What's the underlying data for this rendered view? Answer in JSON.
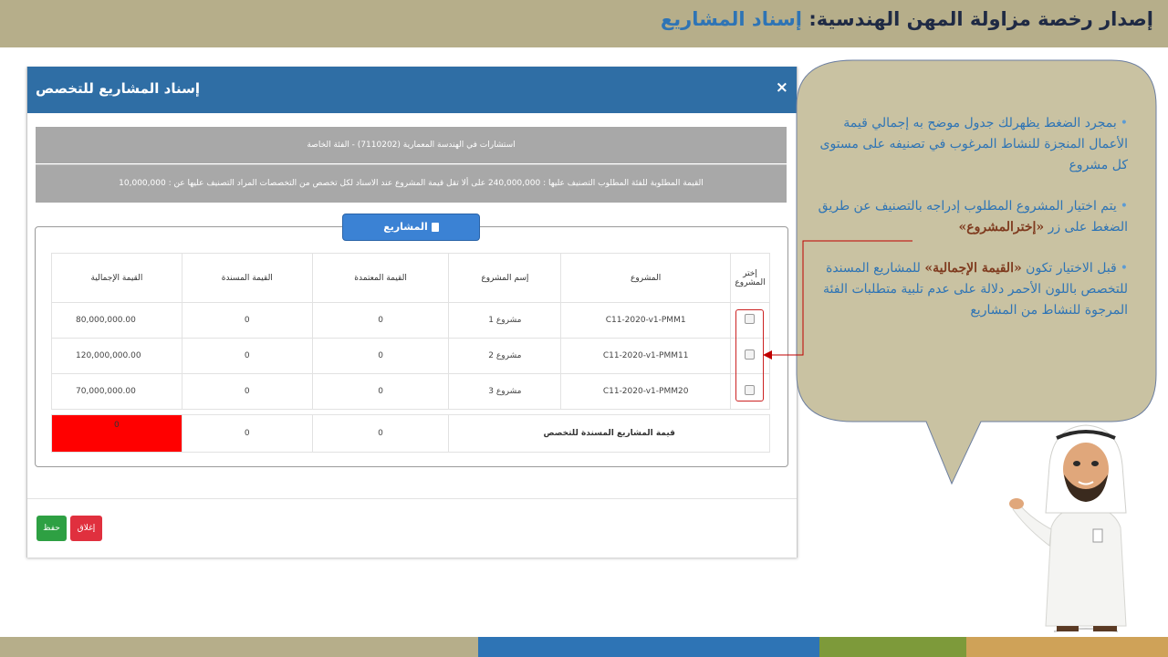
{
  "slide": {
    "title_main": "إصدار رخصة مزاولة المهن الهندسية: ",
    "title_highlight": "إسناد المشاريع"
  },
  "modal": {
    "title": "إسناد المشاريع للتخصص",
    "close_label": "×",
    "spec_line": "استشارات في الهندسة المعمارية (7110202) - الفئة الخاصة",
    "value_line": "القيمة المطلوبة للفئة المطلوب التصنيف عليها : 240,000,000 على ألا تقل قيمة المشروع عند الاسناد لكل تخصص من التخصصات المراد التصنيف عليها عن : 10,000,000",
    "projects_tab_label": "المشاريع",
    "table": {
      "headers": {
        "select": "إختر المشروع",
        "project": "المشروع",
        "project_name": "إسم المشروع",
        "approved_value": "القيمة المعتمدة",
        "assigned_value": "القيمة المسندة",
        "total_value": "القيمة الإجمالية"
      },
      "rows": [
        {
          "project": "C11-2020-v1-PMM1",
          "project_name": "مشروع 1",
          "approved_value": "0",
          "assigned_value": "0",
          "total_value": "80,000,000.00"
        },
        {
          "project": "C11-2020-v1-PMM11",
          "project_name": "مشروع 2",
          "approved_value": "0",
          "assigned_value": "0",
          "total_value": "120,000,000.00"
        },
        {
          "project": "C11-2020-v1-PMM20",
          "project_name": "مشروع 3",
          "approved_value": "0",
          "assigned_value": "0",
          "total_value": "70,000,000.00"
        }
      ]
    },
    "summary": {
      "label": "قيمة المشاريع المسندة للتخصص",
      "approved_value": "0",
      "assigned_value": "0",
      "total_value": "0"
    },
    "buttons": {
      "save": "حفظ",
      "close": "إغلاق"
    }
  },
  "callout": {
    "bullet_symbol": "•",
    "bullet1": "بمجرد الضغط يظهرلك جدول موضح به إجمالي قيمة الأعمال المنجزة للنشاط المرغوب في تصنيفه على مستوى كل مشروع",
    "bullet2_text": "يتم اختيار المشروع المطلوب إدراجه بالتصنيف عن طريق الضغط على زر ",
    "bullet2_highlight": "«إخترالمشروع»",
    "bullet3_prefix": "قبل الاختيار تكون ",
    "bullet3_highlight": "«القيمة الإجمالية»",
    "bullet3_suffix": " للمشاريع المسندة للتخصص باللون الأحمر دلالة على عدم تلبية متطلبات الفئة المرجوة للنشاط من المشاريع"
  },
  "colors": {
    "header_bar": "#b6ae8a",
    "modal_header": "#2f6ea5",
    "grey_box": "#a8a8a8",
    "projects_tab": "#3b82d4",
    "save_button": "#2ea043",
    "close_button": "#e0303e",
    "insufficient_value": "#ff0000",
    "callout_fill": "#c9c2a2",
    "callout_text": "#2e74b5",
    "callout_highlight": "#7f3b1f"
  }
}
